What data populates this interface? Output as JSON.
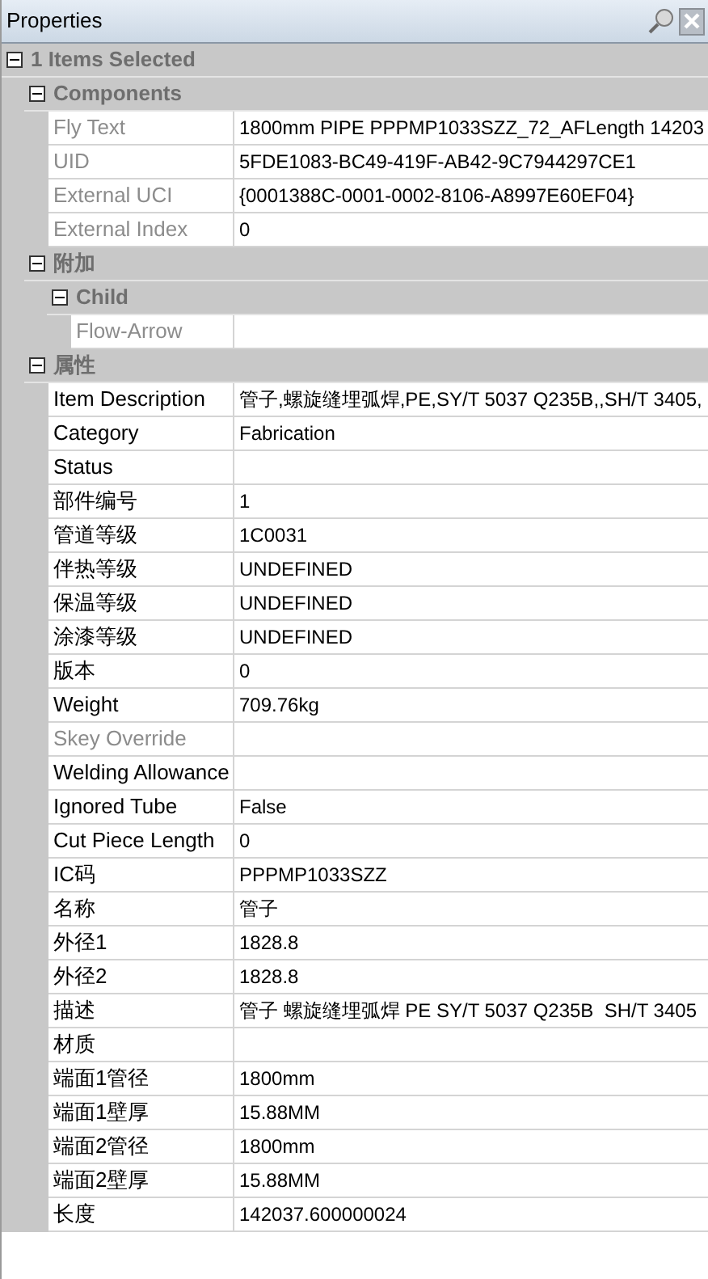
{
  "window": {
    "title": "Properties"
  },
  "tree": [
    {
      "kind": "category",
      "label": "1 Items Selected",
      "expanded": true,
      "children": [
        {
          "kind": "category",
          "label": "Components",
          "expanded": true,
          "children": [
            {
              "kind": "property",
              "name": "Fly Text",
              "value": "1800mm PIPE PPPMP1033SZZ_72_AFLength 14203",
              "readonly": true
            },
            {
              "kind": "property",
              "name": "UID",
              "value": "5FDE1083-BC49-419F-AB42-9C7944297CE1",
              "readonly": true
            },
            {
              "kind": "property",
              "name": "External UCI",
              "value": "{0001388C-0001-0002-8106-A8997E60EF04}",
              "readonly": true
            },
            {
              "kind": "property",
              "name": "External Index",
              "value": "0",
              "readonly": true
            }
          ]
        },
        {
          "kind": "category",
          "label": "附加",
          "expanded": true,
          "children": [
            {
              "kind": "category",
              "label": "Child",
              "expanded": true,
              "children": [
                {
                  "kind": "property",
                  "name": "Flow-Arrow",
                  "readonly": true
                }
              ]
            }
          ]
        },
        {
          "kind": "category",
          "label": "属性",
          "expanded": true,
          "children": [
            {
              "kind": "property",
              "name": "Item Description",
              "value": "管子,螺旋缝埋弧焊,PE,SY/T 5037 Q235B,,SH/T 3405,",
              "readonly": false
            },
            {
              "kind": "property",
              "name": "Category",
              "value": "Fabrication",
              "readonly": false
            },
            {
              "kind": "property",
              "name": "Status",
              "readonly": false
            },
            {
              "kind": "property",
              "name": "部件编号",
              "value": "1",
              "readonly": false
            },
            {
              "kind": "property",
              "name": "管道等级",
              "value": "1C0031",
              "readonly": false
            },
            {
              "kind": "property",
              "name": "伴热等级",
              "value": "UNDEFINED",
              "readonly": false
            },
            {
              "kind": "property",
              "name": "保温等级",
              "value": "UNDEFINED",
              "readonly": false
            },
            {
              "kind": "property",
              "name": "涂漆等级",
              "value": "UNDEFINED",
              "readonly": false
            },
            {
              "kind": "property",
              "name": "版本",
              "value": "0",
              "readonly": false
            },
            {
              "kind": "property",
              "name": "Weight",
              "value": "709.76kg",
              "readonly": false
            },
            {
              "kind": "property",
              "name": "Skey Override",
              "readonly": true
            },
            {
              "kind": "property",
              "name": "Welding Allowance",
              "readonly": false
            },
            {
              "kind": "property",
              "name": "Ignored Tube",
              "value": "False",
              "readonly": false
            },
            {
              "kind": "property",
              "name": "Cut Piece Length",
              "value": "0",
              "readonly": false
            },
            {
              "kind": "property",
              "name": "IC码",
              "value": "PPPMP1033SZZ",
              "readonly": false
            },
            {
              "kind": "property",
              "name": "名称",
              "value": "管子",
              "readonly": false
            },
            {
              "kind": "property",
              "name": "外径1",
              "value": "1828.8",
              "readonly": false
            },
            {
              "kind": "property",
              "name": "外径2",
              "value": "1828.8",
              "readonly": false
            },
            {
              "kind": "property",
              "name": "描述",
              "value": "管子 螺旋缝埋弧焊 PE SY/T 5037 Q235B  SH/T 3405",
              "readonly": false
            },
            {
              "kind": "property",
              "name": "材质",
              "readonly": false
            },
            {
              "kind": "property",
              "name": "端面1管径",
              "value": "1800mm",
              "readonly": false
            },
            {
              "kind": "property",
              "name": "端面1壁厚",
              "value": "15.88MM",
              "readonly": false
            },
            {
              "kind": "property",
              "name": "端面2管径",
              "value": "1800mm",
              "readonly": false
            },
            {
              "kind": "property",
              "name": "端面2壁厚",
              "value": "15.88MM",
              "readonly": false
            },
            {
              "kind": "property",
              "name": "长度",
              "value": "142037.600000024",
              "readonly": false
            }
          ]
        }
      ]
    }
  ]
}
